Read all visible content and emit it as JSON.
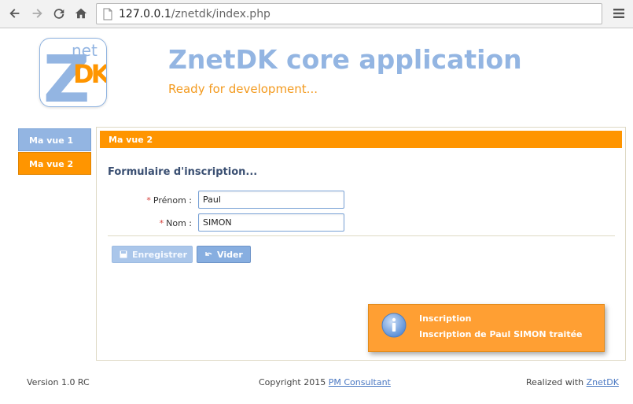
{
  "browser": {
    "url_host": "127.0.0.1",
    "url_path": "/znetdk/index.php",
    "icons": [
      "back-arrow-icon",
      "forward-arrow-icon",
      "reload-icon",
      "home-icon",
      "page-icon",
      "menu-icon"
    ]
  },
  "header": {
    "logo": {
      "top": "net",
      "letters": "DK",
      "big": "Z"
    },
    "title": "ZnetDK core application",
    "subtitle": "Ready for development..."
  },
  "sidebar": {
    "items": [
      {
        "label": "Ma vue 1",
        "active": false
      },
      {
        "label": "Ma vue 2",
        "active": true
      }
    ]
  },
  "main": {
    "panel_title": "Ma vue 2",
    "form_title": "Formulaire d'inscription...",
    "fields": [
      {
        "required_mark": "*",
        "label": "Prénom :",
        "value": "Paul"
      },
      {
        "required_mark": "*",
        "label": "Nom :",
        "value": "SIMON"
      }
    ],
    "buttons": {
      "save_label": "Enregistrer",
      "clear_label": "Vider"
    }
  },
  "notification": {
    "title": "Inscription",
    "message": "Inscription de Paul SIMON traitée"
  },
  "footer": {
    "version": "Version 1.0 RC",
    "copyright_prefix": "Copyright 2015",
    "copyright_link": "PM Consultant",
    "realized_prefix": "Realized with",
    "realized_link": "ZnetDK"
  },
  "colors": {
    "accent_blue": "#93b5e2",
    "accent_orange": "#ff9500",
    "subtitle_orange": "#f39a1e"
  }
}
